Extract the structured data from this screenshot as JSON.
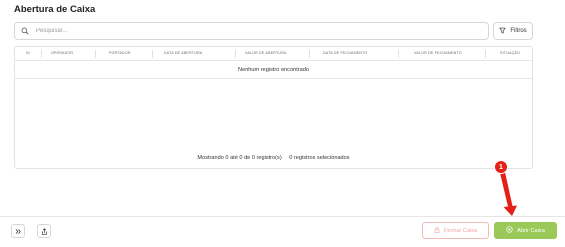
{
  "page": {
    "title": "Abertura de Caixa"
  },
  "search": {
    "placeholder": "Pesquisar..."
  },
  "filters": {
    "label": "Filtros"
  },
  "table": {
    "columns": [
      "ID",
      "OPERADOR",
      "PORTADOR",
      "DATA DE ABERTURA",
      "VALOR DE ABERTURA",
      "DATA DE FECHAMENTO",
      "VALOR DE FECHAMENTO",
      "SITUAÇÃO"
    ],
    "empty_message": "Nenhum registro encontrado",
    "footer": {
      "showing": "Mostrando 0 até 0 de 0 registro(s)",
      "selected": "0 registros selecionados"
    }
  },
  "actions": {
    "close_cash": "Fechar Caixa",
    "open_cash": "Abrir Caixa"
  },
  "annotation": {
    "step": "1"
  },
  "icons": {
    "search": "search-icon",
    "filter": "filter-icon",
    "expand": "double-chevron-icon",
    "share": "share-icon",
    "lock": "lock-icon",
    "plus": "plus-circle-icon"
  },
  "colors": {
    "primary": "#9ac95a",
    "danger": "#e32118",
    "close_border": "#f2bcbc"
  }
}
